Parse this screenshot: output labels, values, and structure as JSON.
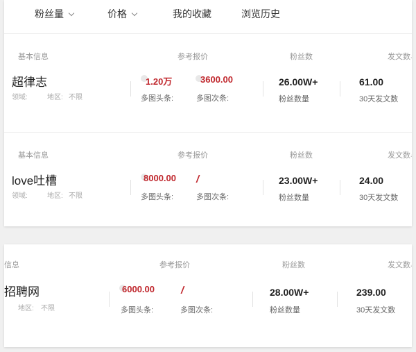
{
  "tabs": [
    {
      "label": "粉丝量",
      "has_dropdown": true
    },
    {
      "label": "价格",
      "has_dropdown": true
    },
    {
      "label": "我的收藏",
      "has_dropdown": false
    },
    {
      "label": "浏览历史",
      "has_dropdown": false
    }
  ],
  "headers": {
    "basic_info": "基本信息",
    "basic_info_cut": "信息",
    "ref_price": "参考报价",
    "fans": "粉丝数",
    "posts": "发文数与"
  },
  "common": {
    "domain_label": "领域:",
    "region_label": "地区:",
    "region_value": "不限",
    "headline_label": "多图头条:",
    "secondary_label": "多图次条:",
    "fans_sub": "粉丝数量",
    "posts_sub": "30天发文数"
  },
  "accounts": [
    {
      "name": "超律志",
      "headline_price": "1.20万",
      "secondary_price": "3600.00",
      "fans": "26.00W+",
      "posts": "61.00"
    },
    {
      "name": "love吐槽",
      "headline_price": "8000.00",
      "secondary_price": "/",
      "fans": "23.00W+",
      "posts": "24.00"
    },
    {
      "name": "招聘网",
      "headline_price": "6000.00",
      "secondary_price": "/",
      "fans": "28.00W+",
      "posts": "239.00"
    }
  ],
  "colors": {
    "price": "#c0272d",
    "background": "#f0f0f0",
    "card": "#ffffff"
  }
}
